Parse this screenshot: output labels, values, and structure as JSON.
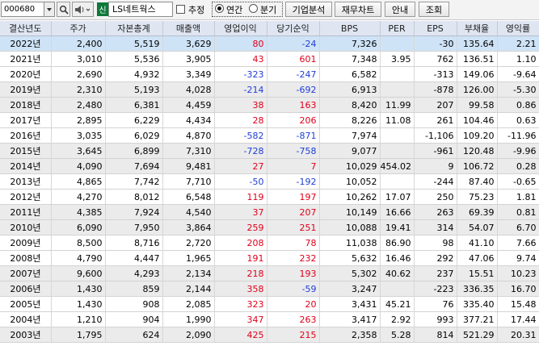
{
  "toolbar": {
    "code": "000680",
    "company_name": "LS네트웍스",
    "badge": "신",
    "estimate_label": "추정",
    "radio_annual": "연간",
    "radio_quarter": "분기",
    "buttons": [
      "기업분석",
      "재무차트",
      "안내",
      "조회"
    ]
  },
  "table": {
    "headers": [
      "결산년도",
      "주가",
      "자본총계",
      "매출액",
      "영업이익",
      "당기순익",
      "BPS",
      "PER",
      "EPS",
      "부채율",
      "영익률"
    ],
    "rows": [
      {
        "year": "2022년",
        "price": "2,400",
        "equity": "5,519",
        "sales": "3,629",
        "op": "80",
        "net": "-24",
        "bps": "7,326",
        "per": "",
        "eps": "-30",
        "debt": "135.64",
        "opm": "2.21"
      },
      {
        "year": "2021년",
        "price": "3,010",
        "equity": "5,536",
        "sales": "3,905",
        "op": "43",
        "net": "601",
        "bps": "7,348",
        "per": "3.95",
        "eps": "762",
        "debt": "136.51",
        "opm": "1.10"
      },
      {
        "year": "2020년",
        "price": "2,690",
        "equity": "4,932",
        "sales": "3,349",
        "op": "-323",
        "net": "-247",
        "bps": "6,582",
        "per": "",
        "eps": "-313",
        "debt": "149.06",
        "opm": "-9.64"
      },
      {
        "year": "2019년",
        "price": "2,310",
        "equity": "5,193",
        "sales": "4,028",
        "op": "-214",
        "net": "-692",
        "bps": "6,913",
        "per": "",
        "eps": "-878",
        "debt": "126.00",
        "opm": "-5.30"
      },
      {
        "year": "2018년",
        "price": "2,480",
        "equity": "6,381",
        "sales": "4,459",
        "op": "38",
        "net": "163",
        "bps": "8,420",
        "per": "11.99",
        "eps": "207",
        "debt": "99.58",
        "opm": "0.86"
      },
      {
        "year": "2017년",
        "price": "2,895",
        "equity": "6,229",
        "sales": "4,434",
        "op": "28",
        "net": "206",
        "bps": "8,226",
        "per": "11.08",
        "eps": "261",
        "debt": "104.46",
        "opm": "0.63"
      },
      {
        "year": "2016년",
        "price": "3,035",
        "equity": "6,029",
        "sales": "4,870",
        "op": "-582",
        "net": "-871",
        "bps": "7,974",
        "per": "",
        "eps": "-1,106",
        "debt": "109.20",
        "opm": "-11.96"
      },
      {
        "year": "2015년",
        "price": "3,645",
        "equity": "6,899",
        "sales": "7,310",
        "op": "-728",
        "net": "-758",
        "bps": "9,077",
        "per": "",
        "eps": "-961",
        "debt": "120.48",
        "opm": "-9.96"
      },
      {
        "year": "2014년",
        "price": "4,090",
        "equity": "7,694",
        "sales": "9,481",
        "op": "27",
        "net": "7",
        "bps": "10,029",
        "per": "454.02",
        "eps": "9",
        "debt": "106.72",
        "opm": "0.28"
      },
      {
        "year": "2013년",
        "price": "4,865",
        "equity": "7,742",
        "sales": "7,710",
        "op": "-50",
        "net": "-192",
        "bps": "10,052",
        "per": "",
        "eps": "-244",
        "debt": "87.40",
        "opm": "-0.65"
      },
      {
        "year": "2012년",
        "price": "4,270",
        "equity": "8,012",
        "sales": "6,548",
        "op": "119",
        "net": "197",
        "bps": "10,262",
        "per": "17.07",
        "eps": "250",
        "debt": "75.23",
        "opm": "1.81"
      },
      {
        "year": "2011년",
        "price": "4,385",
        "equity": "7,924",
        "sales": "4,540",
        "op": "37",
        "net": "207",
        "bps": "10,149",
        "per": "16.66",
        "eps": "263",
        "debt": "69.39",
        "opm": "0.81"
      },
      {
        "year": "2010년",
        "price": "6,090",
        "equity": "7,950",
        "sales": "3,864",
        "op": "259",
        "net": "251",
        "bps": "10,088",
        "per": "19.41",
        "eps": "314",
        "debt": "54.07",
        "opm": "6.70"
      },
      {
        "year": "2009년",
        "price": "8,500",
        "equity": "8,716",
        "sales": "2,720",
        "op": "208",
        "net": "78",
        "bps": "11,038",
        "per": "86.90",
        "eps": "98",
        "debt": "41.10",
        "opm": "7.66"
      },
      {
        "year": "2008년",
        "price": "4,790",
        "equity": "4,447",
        "sales": "1,965",
        "op": "191",
        "net": "232",
        "bps": "5,632",
        "per": "16.46",
        "eps": "292",
        "debt": "47.06",
        "opm": "9.74"
      },
      {
        "year": "2007년",
        "price": "9,600",
        "equity": "4,293",
        "sales": "2,134",
        "op": "218",
        "net": "193",
        "bps": "5,302",
        "per": "40.62",
        "eps": "237",
        "debt": "15.51",
        "opm": "10.23"
      },
      {
        "year": "2006년",
        "price": "1,430",
        "equity": "859",
        "sales": "2,144",
        "op": "358",
        "net": "-59",
        "bps": "3,247",
        "per": "",
        "eps": "-223",
        "debt": "336.35",
        "opm": "16.70"
      },
      {
        "year": "2005년",
        "price": "1,430",
        "equity": "908",
        "sales": "2,085",
        "op": "323",
        "net": "20",
        "bps": "3,431",
        "per": "45.21",
        "eps": "76",
        "debt": "335.40",
        "opm": "15.48"
      },
      {
        "year": "2004년",
        "price": "1,210",
        "equity": "904",
        "sales": "1,990",
        "op": "347",
        "net": "263",
        "bps": "3,417",
        "per": "2.92",
        "eps": "993",
        "debt": "377.21",
        "opm": "17.44"
      },
      {
        "year": "2003년",
        "price": "1,795",
        "equity": "624",
        "sales": "2,090",
        "op": "425",
        "net": "215",
        "bps": "2,358",
        "per": "5.28",
        "eps": "814",
        "debt": "521.29",
        "opm": "20.31"
      }
    ]
  },
  "colors": {
    "positive": "#e0001a",
    "negative": "#1f3ed6",
    "header_bg": "#dfe6f2",
    "selected_row": "#cfe3f7",
    "alt_row": "#ebebeb",
    "badge": "#0d7a3a"
  }
}
